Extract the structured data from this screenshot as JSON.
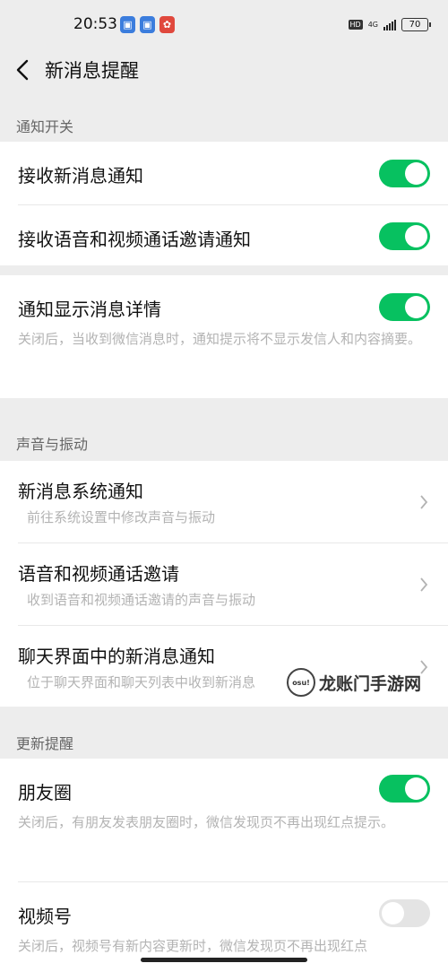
{
  "status_bar": {
    "time": "20:53",
    "hd": "HD",
    "network": "4G",
    "battery": "70"
  },
  "header": {
    "title": "新消息提醒"
  },
  "sections": {
    "notify_switch": {
      "header": "通知开关",
      "receive_new": {
        "title": "接收新消息通知",
        "enabled": true
      },
      "receive_call": {
        "title": "接收语音和视频通话邀请通知",
        "enabled": true
      },
      "show_detail": {
        "title": "通知显示消息详情",
        "enabled": true,
        "desc": "关闭后，当收到微信消息时，通知提示将不显示发信人和内容摘要。"
      }
    },
    "sound_vibration": {
      "header": "声音与振动",
      "system_notify": {
        "title": "新消息系统通知",
        "desc": "前往系统设置中修改声音与振动"
      },
      "call_invite": {
        "title": "语音和视频通话邀请",
        "desc": "收到语音和视频通话邀请的声音与振动"
      },
      "chat_notify": {
        "title": "聊天界面中的新消息通知",
        "desc": "位于聊天界面和聊天列表中收到新消息"
      }
    },
    "update_remind": {
      "header": "更新提醒",
      "moments": {
        "title": "朋友圈",
        "enabled": true,
        "desc": "关闭后，有朋友发表朋友圈时，微信发现页不再出现红点提示。"
      },
      "channels": {
        "title": "视频号",
        "enabled": false,
        "desc": "关闭后，视频号有新内容更新时，微信发现页不再出现红点"
      }
    }
  },
  "watermark": {
    "logo_text": "osu!",
    "text": "龙账门手游网"
  },
  "colors": {
    "toggle_on": "#07c160",
    "toggle_off": "#e4e4e4",
    "background": "#ededed"
  }
}
